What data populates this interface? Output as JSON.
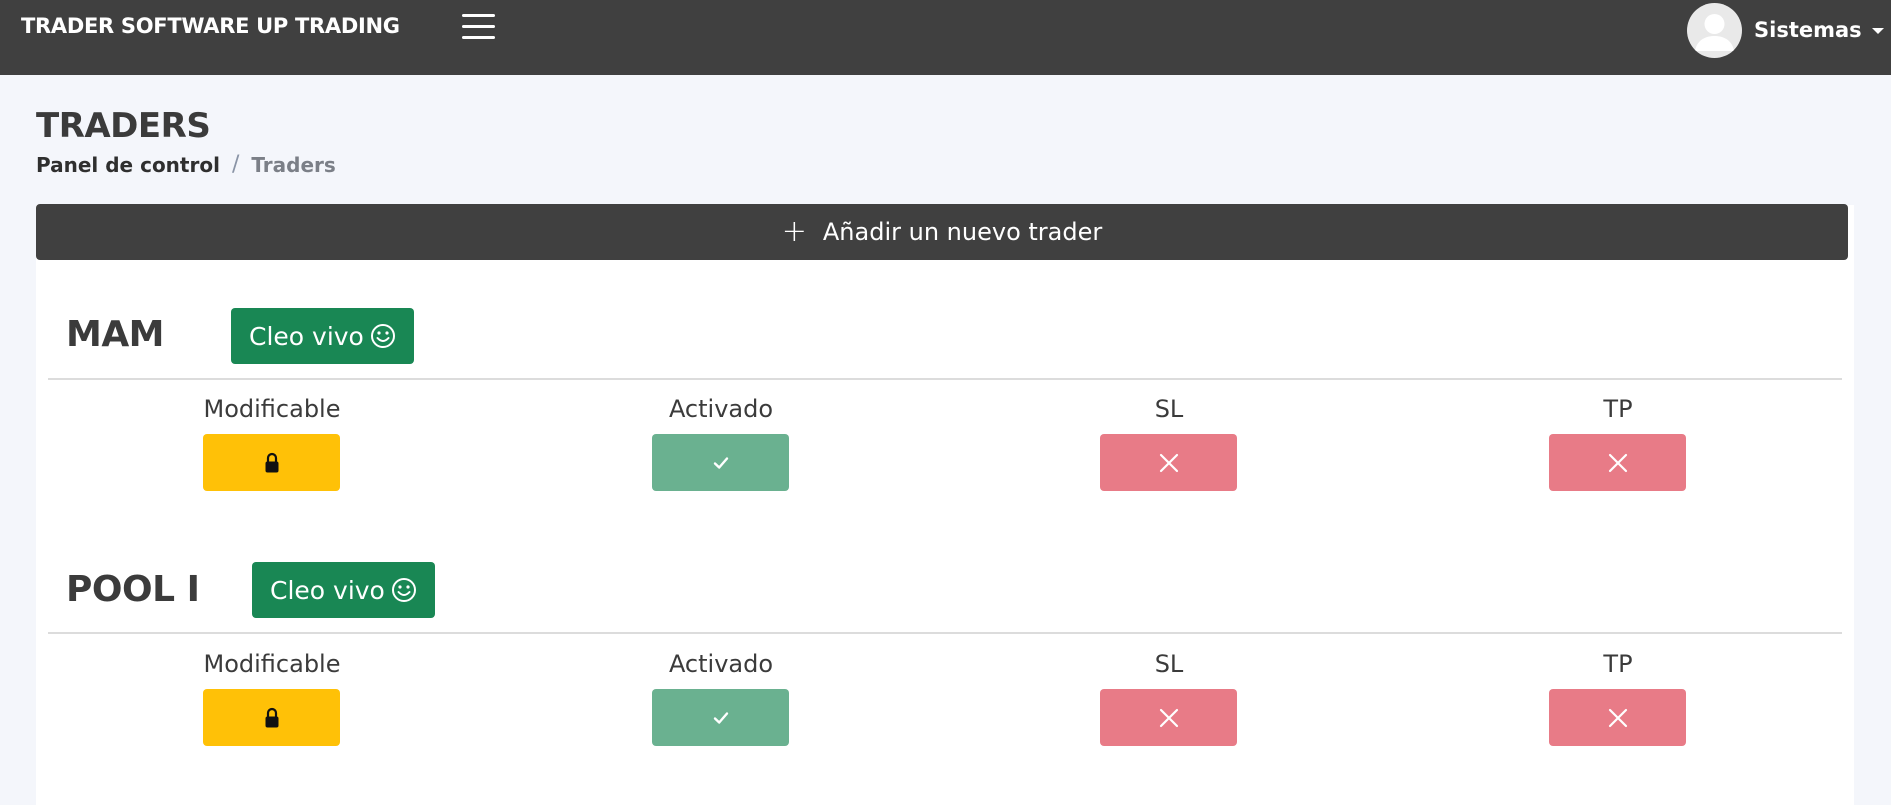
{
  "header": {
    "brand": "TRADER SOFTWARE UP TRADING",
    "user_name": "Sistemas",
    "menu_icon": "hamburger-icon",
    "avatar_icon": "user-avatar-icon"
  },
  "page": {
    "title": "TRADERS",
    "breadcrumb": {
      "home": "Panel de control",
      "separator": "/",
      "current": "Traders"
    }
  },
  "actions": {
    "add_trader": "Añadir un nuevo trader",
    "add_icon": "plus-icon"
  },
  "columns": [
    "Modificable",
    "Activado",
    "SL",
    "TP"
  ],
  "sections": [
    {
      "name": "MAM",
      "trader_label": "Cleo vivo",
      "trader_icon": "smile-icon",
      "states": {
        "modificable": "lock-icon",
        "activado": "check-icon",
        "sl": "x-icon",
        "tp": "x-icon"
      }
    },
    {
      "name": "POOL I",
      "trader_label": "Cleo vivo",
      "trader_icon": "smile-icon",
      "states": {
        "modificable": "lock-icon",
        "activado": "check-icon",
        "sl": "x-icon",
        "tp": "x-icon"
      }
    }
  ],
  "colors": {
    "topbar": "#404040",
    "success": "#198754",
    "success_muted": "#6ab190",
    "warning": "#ffc107",
    "danger": "#e87b87"
  }
}
